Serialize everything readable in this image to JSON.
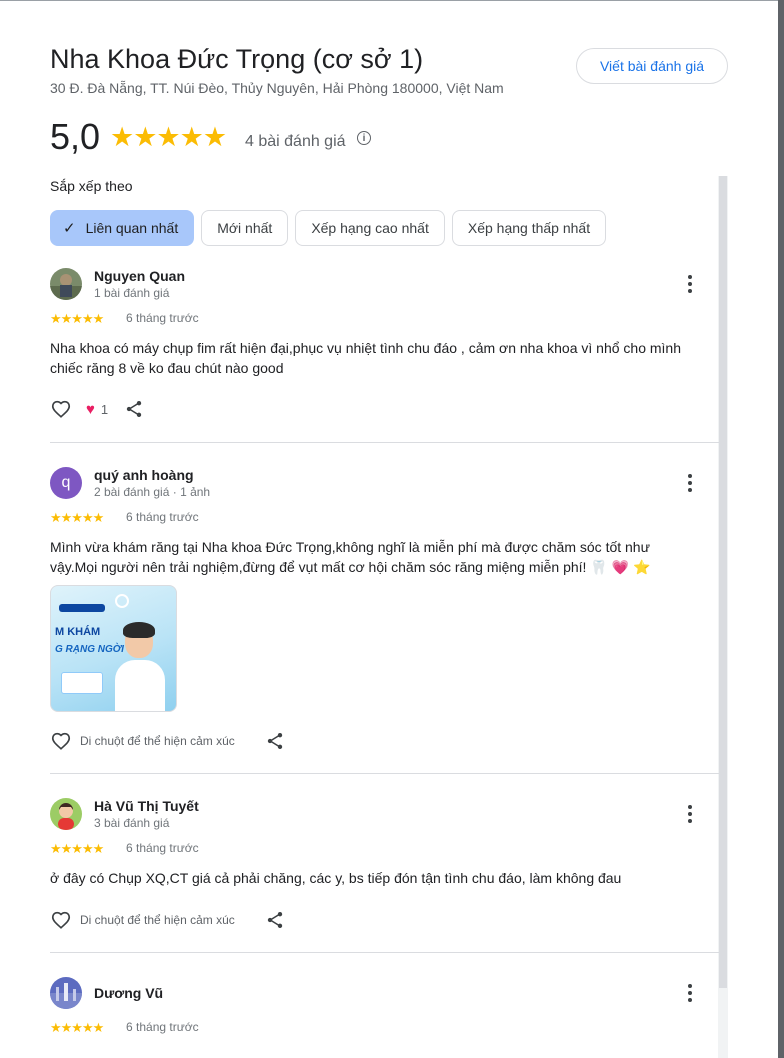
{
  "place": {
    "title": "Nha Khoa Đức Trọng (cơ sở 1)",
    "address": "30 Đ. Đà Nẵng, TT. Núi Đèo, Thủy Nguyên, Hải Phòng 180000, Việt Nam",
    "write_review_label": "Viết bài đánh giá",
    "rating": "5,0",
    "stars": "★★★★★",
    "review_count": "4 bài đánh giá",
    "info_icon": "i"
  },
  "sort": {
    "label": "Sắp xếp theo",
    "chips": [
      {
        "label": "Liên quan nhất",
        "selected": true
      },
      {
        "label": "Mới nhất",
        "selected": false
      },
      {
        "label": "Xếp hạng cao nhất",
        "selected": false
      },
      {
        "label": "Xếp hạng thấp nhất",
        "selected": false
      }
    ]
  },
  "reviews": [
    {
      "name": "Nguyen Quan",
      "meta": "1 bài đánh giá",
      "stars": "★★★★★",
      "time": "6 tháng trước",
      "text": "Nha khoa có máy chụp fim rất hiện đại,phục vụ nhiệt tình chu đáo , cảm ơn nha khoa vì nhổ cho mình chiếc răng 8 về ko đau chút nào good",
      "reaction_count": "1",
      "reaction_icon": "heart-icon"
    },
    {
      "name": "quý anh hoàng",
      "avatar_letter": "q",
      "meta": "2 bài đánh giá · 1 ảnh",
      "stars": "★★★★★",
      "time": "6 tháng trước",
      "text": "Mình vừa khám răng tại Nha khoa Đức Trọng,không nghĩ là miễn phí mà được chăm sóc tốt như vậy.Mọi người nên trải nghiệm,đừng để vụt mất cơ hội chăm sóc răng miệng miễn phí! 🦷 💗 ⭐",
      "photo_text_1": "M KHÁM",
      "photo_text_2": "G RẠNG NGỜI",
      "hint": "Di chuột để thể hiện cảm xúc"
    },
    {
      "name": "Hà Vũ Thị Tuyết",
      "meta": "3 bài đánh giá",
      "stars": "★★★★★",
      "time": "6 tháng trước",
      "text": "ở đây có Chụp XQ,CT giá cả phải chăng, các y, bs tiếp đón tận tình chu đáo, làm không đau",
      "hint": "Di chuột để thể hiện cảm xúc"
    },
    {
      "name": "Dương Vũ",
      "meta": "",
      "stars": "★★★★★",
      "time": "6 tháng trước"
    }
  ],
  "colors": {
    "accent": "#1a73e8",
    "star": "#fbbc04",
    "chip_selected": "#a8c7fa",
    "heart": "#e91e63"
  }
}
